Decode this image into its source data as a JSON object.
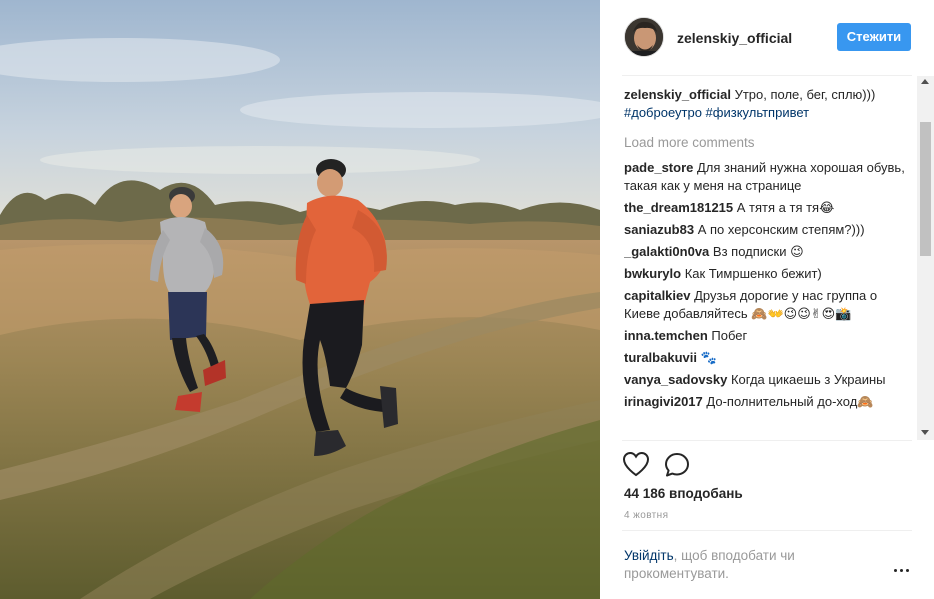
{
  "post": {
    "author": "zelenskiy_official",
    "follow_label": "Стежити",
    "caption_user": "zelenskiy_official",
    "caption_text": "Утро, поле, бег, сплю)))",
    "hashtags": "#доброеутро #физкультпривет",
    "load_more": "Load more comments",
    "likes": "44 186 вподобань",
    "date": "4 жовтня",
    "login_link": "Увійдіть",
    "login_rest": ", щоб вподобати чи прокоментувати."
  },
  "comments": [
    {
      "user": "pade_store",
      "text": "Для знаний нужна хорошая обувь, такая как у меня на странице"
    },
    {
      "user": "the_dream181215",
      "text": "А тятя а тя тя😂"
    },
    {
      "user": "saniazub83",
      "text": "А по херсонским степям?)))"
    },
    {
      "user": "_galakti0n0va",
      "text": "Вз подписки 😉"
    },
    {
      "user": "bwkurylo",
      "text": "Как Тимршенко бежит)"
    },
    {
      "user": "capitalkiev",
      "text": "Друзья дорогие у нас группа о Киеве добавляйтесь 🙈👐😉😉✌😍📸"
    },
    {
      "user": "inna.temchen",
      "text": "Побег"
    },
    {
      "user": "turalbakuvii",
      "text": "🐾"
    },
    {
      "user": "vanya_sadovsky",
      "text": "Когда цикаешь з Украины"
    },
    {
      "user": "irinagivi2017",
      "text": "До-полнительный до-ход🙈"
    }
  ],
  "icons": {
    "like": "heart-icon",
    "comment": "speech-bubble-icon",
    "more": "more-options-icon"
  },
  "colors": {
    "accent": "#3897f0",
    "link": "#003569",
    "muted": "#999999"
  }
}
